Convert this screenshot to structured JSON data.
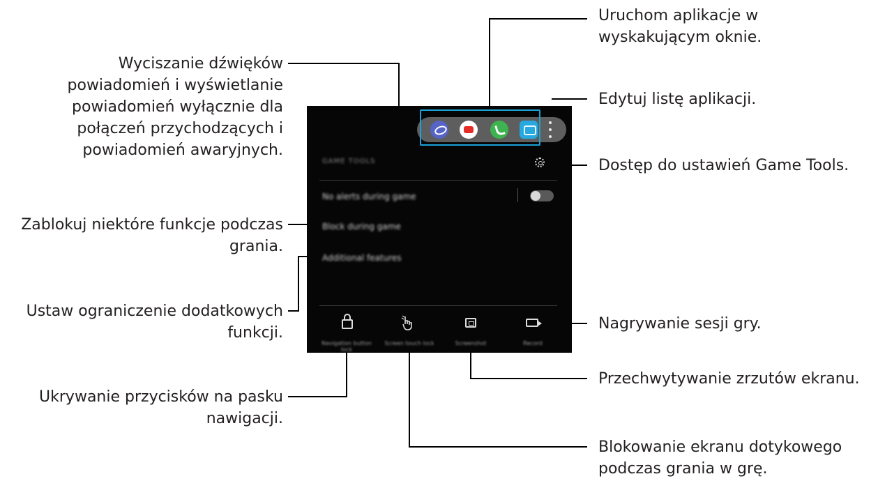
{
  "callouts": {
    "popup_apps": "Uruchom aplikacje w\nwyskakującym oknie.",
    "edit_apps": "Edytuj listę aplikacji.",
    "game_tools_settings": "Dostęp do ustawień Game Tools.",
    "record": "Nagrywanie sesji gry.",
    "screenshot": "Przechwytywanie zrzutów ekranu.",
    "touch_lock": "Blokowanie ekranu dotykowego\npodczas grania w grę.",
    "no_alerts": "Wyciszanie dźwięków\npowiadomień i wyświetlanie\npowiadomień wyłącznie dla\npołączeń przychodzących i\npowiadomień awaryjnych.",
    "block_during_game": "Zablokuj niektóre funkcje podczas\ngrania.",
    "additional_features": "Ustaw ograniczenie dodatkowych\nfunkcji.",
    "nav_lock": "Ukrywanie przycisków na pasku\nnawigacji."
  },
  "screen": {
    "header": "GAME TOOLS",
    "menu": {
      "no_alerts": "No alerts during game",
      "block": "Block during game",
      "additional": "Additional features"
    },
    "toggle_on": false,
    "apps": [
      "browser-icon",
      "youtube-icon",
      "phone-icon",
      "messages-icon"
    ],
    "tools": {
      "nav_lock": "Navigation button lock",
      "touch_lock": "Screen touch lock",
      "screenshot": "Screenshot",
      "record": "Record"
    }
  }
}
